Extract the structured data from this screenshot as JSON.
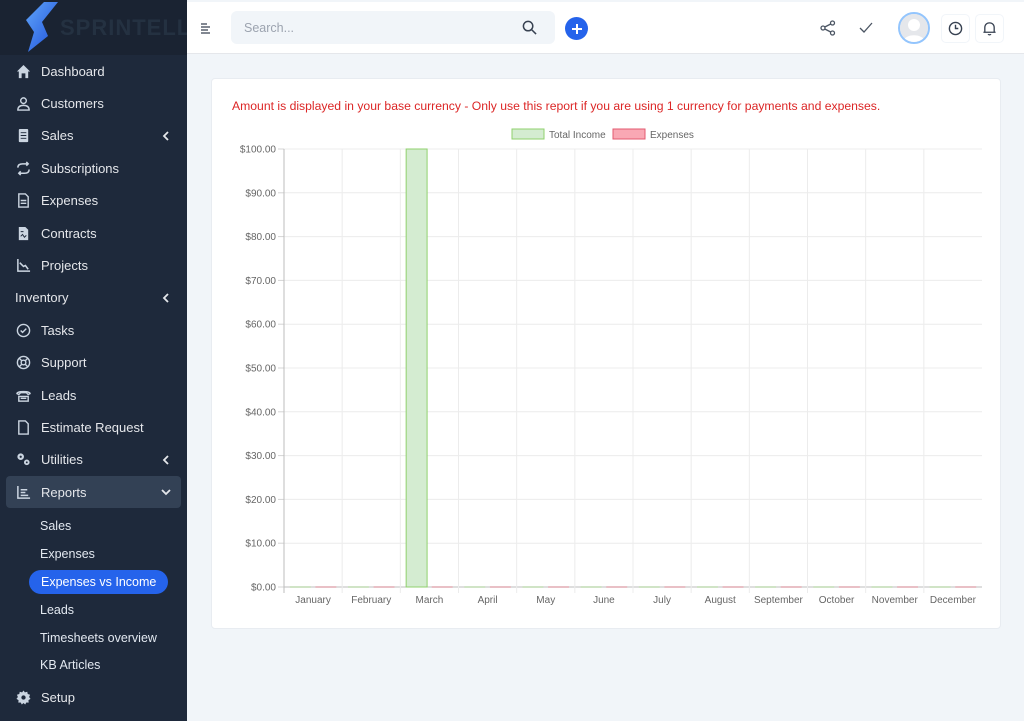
{
  "brand": {
    "name": "SPRINTELL"
  },
  "sidebar": {
    "items": [
      {
        "label": "Dashboard",
        "icon": "home-icon"
      },
      {
        "label": "Customers",
        "icon": "user-icon"
      },
      {
        "label": "Sales",
        "icon": "receipt-icon",
        "chevron": "left"
      },
      {
        "label": "Subscriptions",
        "icon": "refresh-icon"
      },
      {
        "label": "Expenses",
        "icon": "document-icon"
      },
      {
        "label": "Contracts",
        "icon": "contract-icon"
      },
      {
        "label": "Projects",
        "icon": "chart-line-icon"
      },
      {
        "label": "Inventory",
        "icon": "",
        "chevron": "left"
      },
      {
        "label": "Tasks",
        "icon": "check-circle-icon"
      },
      {
        "label": "Support",
        "icon": "lifebuoy-icon"
      },
      {
        "label": "Leads",
        "icon": "phone-icon"
      },
      {
        "label": "Estimate Request",
        "icon": "file-icon"
      },
      {
        "label": "Utilities",
        "icon": "cogs-icon",
        "chevron": "left"
      },
      {
        "label": "Reports",
        "icon": "bar-chart-icon",
        "chevron": "down"
      }
    ],
    "reports_sub": [
      {
        "label": "Sales"
      },
      {
        "label": "Expenses"
      },
      {
        "label": "Expenses vs Income",
        "current": true
      },
      {
        "label": "Leads"
      },
      {
        "label": "Timesheets overview"
      },
      {
        "label": "KB Articles"
      }
    ],
    "setup": {
      "label": "Setup",
      "icon": "gear-icon"
    }
  },
  "header": {
    "search_placeholder": "Search...",
    "search_value": ""
  },
  "report": {
    "notice": "Amount is displayed in your base currency - Only use this report if you are using 1 currency for payments and expenses."
  },
  "colors": {
    "income_fill": "#d4ecd1",
    "income_stroke": "#8fd16d",
    "expense_fill": "#f9a8b4",
    "expense_stroke": "#e35a6f",
    "notice": "#dc2626",
    "accent": "#2563eb"
  },
  "chart_data": {
    "type": "bar",
    "title": "",
    "xlabel": "",
    "ylabel": "",
    "categories": [
      "January",
      "February",
      "March",
      "April",
      "May",
      "June",
      "July",
      "August",
      "September",
      "October",
      "November",
      "December"
    ],
    "series": [
      {
        "name": "Total Income",
        "values": [
          0,
          0,
          100,
          0,
          0,
          0,
          0,
          0,
          0,
          0,
          0,
          0
        ]
      },
      {
        "name": "Expenses",
        "values": [
          0,
          0,
          0,
          0,
          0,
          0,
          0,
          0,
          0,
          0,
          0,
          0
        ]
      }
    ],
    "ylim": [
      0,
      100
    ],
    "yticks": [
      0,
      10,
      20,
      30,
      40,
      50,
      60,
      70,
      80,
      90,
      100
    ],
    "ytick_labels": [
      "$0.00",
      "$10.00",
      "$20.00",
      "$30.00",
      "$40.00",
      "$50.00",
      "$60.00",
      "$70.00",
      "$80.00",
      "$90.00",
      "$100.00"
    ],
    "grid": true,
    "legend": "top-center"
  }
}
